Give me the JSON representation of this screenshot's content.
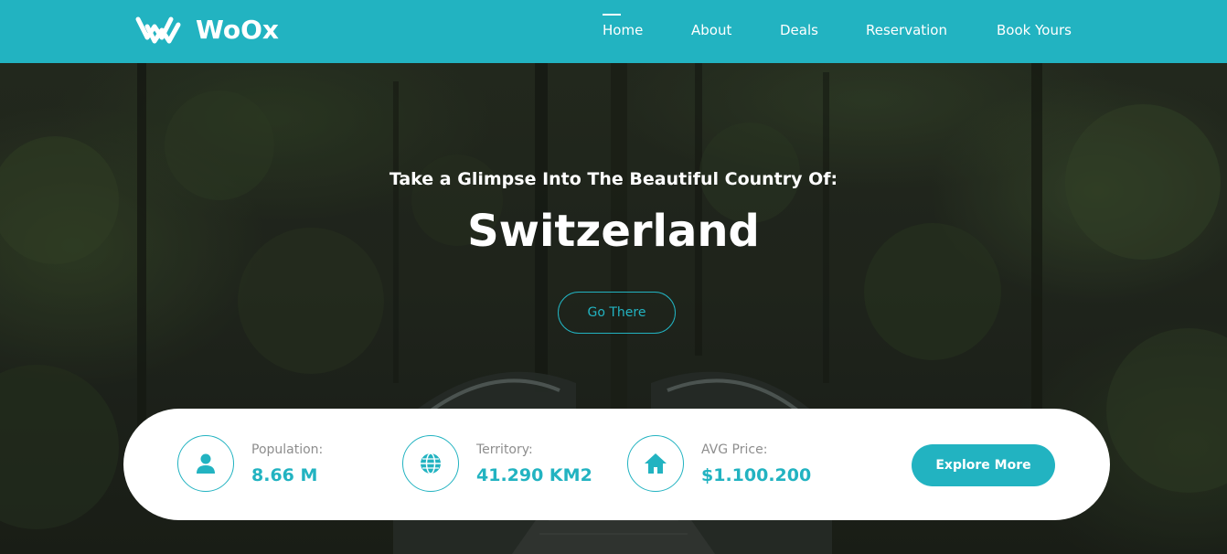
{
  "brand": {
    "name": "WoOx",
    "accent_color": "#22b3c1"
  },
  "nav": {
    "items": [
      {
        "label": "Home",
        "active": true
      },
      {
        "label": "About",
        "active": false
      },
      {
        "label": "Deals",
        "active": false
      },
      {
        "label": "Reservation",
        "active": false
      },
      {
        "label": "Book Yours",
        "active": false
      }
    ]
  },
  "hero": {
    "subtitle": "Take a Glimpse Into The Beautiful Country Of:",
    "title": "Switzerland",
    "cta_label": "Go There",
    "background": "forest-bridge-photo"
  },
  "info": {
    "stats": [
      {
        "icon": "user-icon",
        "label": "Population:",
        "value": "8.66 M"
      },
      {
        "icon": "globe-icon",
        "label": "Territory:",
        "value": "41.290 KM2"
      },
      {
        "icon": "home-icon",
        "label": "AVG Price:",
        "value": "$1.100.200"
      }
    ],
    "explore_label": "Explore More"
  }
}
